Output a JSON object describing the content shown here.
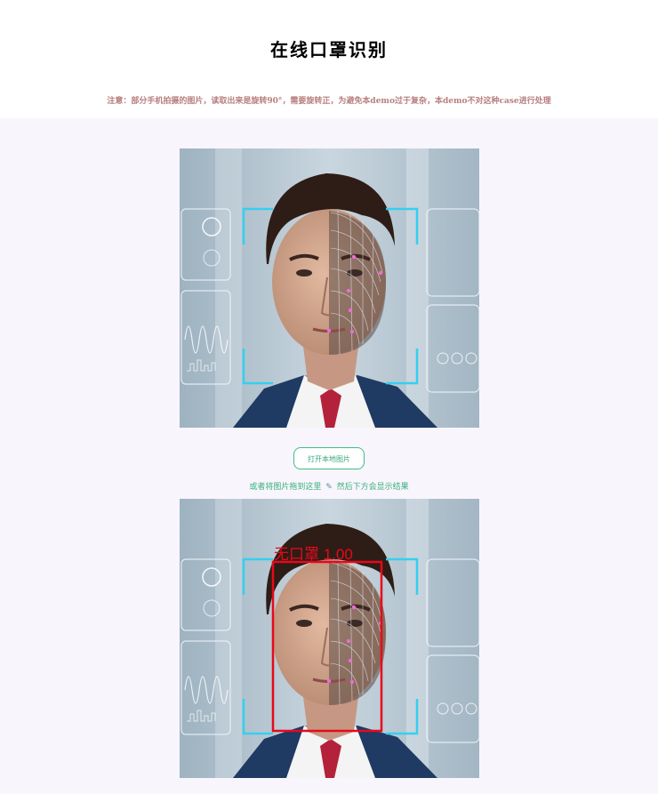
{
  "page": {
    "title": "在线口罩识别",
    "notice": "注意：部分手机拍摄的图片，读取出来是旋转90°，需要旋转正，为避免本demo过于复杂，本demo不对这种case进行处理"
  },
  "upload": {
    "button_label": "打开本地图片",
    "drop_hint_prefix": "或者将图片拖到这里",
    "drop_hint_icon": "pencil-icon",
    "drop_hint_suffix": "然后下方会显示结果"
  },
  "result": {
    "detection_label": "无口罩 1.00",
    "box_color": "#e8081b"
  },
  "colors": {
    "accent": "#3cbf82",
    "notice": "#b87f7f",
    "hud": "#36cff0"
  }
}
